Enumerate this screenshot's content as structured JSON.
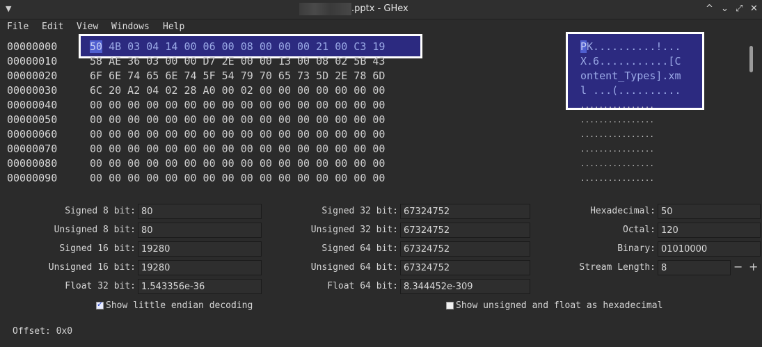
{
  "window": {
    "title": ".pptx - GHex",
    "menu_icon": "chevron-down-icon",
    "controls": [
      "^",
      "⌄",
      "⤢",
      "✕"
    ]
  },
  "menu": {
    "items": [
      "File",
      "Edit",
      "View",
      "Windows",
      "Help"
    ]
  },
  "hex": {
    "rows": [
      {
        "offset": "00000000",
        "bytes": "50 4B 03 04 14 00 06 00 08 00 00 00 21 00 C3 19",
        "ascii": "PK..........!..."
      },
      {
        "offset": "00000010",
        "bytes": "58 AE 36 03 00 00 D7 2E 00 00 13 00 08 02 5B 43",
        "ascii": "X.6...........[C"
      },
      {
        "offset": "00000020",
        "bytes": "6F 6E 74 65 6E 74 5F 54 79 70 65 73 5D 2E 78 6D",
        "ascii": "ontent_Types].xm"
      },
      {
        "offset": "00000030",
        "bytes": "6C 20 A2 04 02 28 A0 00 02 00 00 00 00 00 00 00",
        "ascii": "l ...(.........."
      },
      {
        "offset": "00000040",
        "bytes": "00 00 00 00 00 00 00 00 00 00 00 00 00 00 00 00",
        "ascii": "................"
      },
      {
        "offset": "00000050",
        "bytes": "00 00 00 00 00 00 00 00 00 00 00 00 00 00 00 00",
        "ascii": "................"
      },
      {
        "offset": "00000060",
        "bytes": "00 00 00 00 00 00 00 00 00 00 00 00 00 00 00 00",
        "ascii": "................"
      },
      {
        "offset": "00000070",
        "bytes": "00 00 00 00 00 00 00 00 00 00 00 00 00 00 00 00",
        "ascii": "................"
      },
      {
        "offset": "00000080",
        "bytes": "00 00 00 00 00 00 00 00 00 00 00 00 00 00 00 00",
        "ascii": "................"
      },
      {
        "offset": "00000090",
        "bytes": "00 00 00 00 00 00 00 00 00 00 00 00 00 00 00 00",
        "ascii": "................"
      }
    ]
  },
  "decode": {
    "signed8": {
      "label": "Signed 8 bit:",
      "value": "80"
    },
    "unsigned8": {
      "label": "Unsigned 8 bit:",
      "value": "80"
    },
    "signed16": {
      "label": "Signed 16 bit:",
      "value": "19280"
    },
    "unsigned16": {
      "label": "Unsigned 16 bit:",
      "value": "19280"
    },
    "float32": {
      "label": "Float 32 bit:",
      "value": "1.543356e-36"
    },
    "signed32": {
      "label": "Signed 32 bit:",
      "value": "67324752"
    },
    "unsigned32": {
      "label": "Unsigned 32 bit:",
      "value": "67324752"
    },
    "signed64": {
      "label": "Signed 64 bit:",
      "value": "67324752"
    },
    "unsigned64": {
      "label": "Unsigned 64 bit:",
      "value": "67324752"
    },
    "float64": {
      "label": "Float 64 bit:",
      "value": "8.344452e-309"
    },
    "hexadecimal": {
      "label": "Hexadecimal:",
      "value": "50"
    },
    "octal": {
      "label": "Octal:",
      "value": "120"
    },
    "binary": {
      "label": "Binary:",
      "value": "01010000"
    },
    "stream_length": {
      "label": "Stream Length:",
      "value": "8",
      "minus": "−",
      "plus": "+"
    }
  },
  "options": {
    "little_endian": {
      "label": "Show little endian decoding",
      "checked": true
    },
    "unsigned_hex": {
      "label": "Show unsigned and float as hexadecimal",
      "checked": false
    }
  },
  "status": {
    "offset": "Offset: 0x0"
  },
  "colors": {
    "background": "#2b2b2b",
    "selection": "#2c2a80",
    "cursor": "#4f5fd0"
  }
}
